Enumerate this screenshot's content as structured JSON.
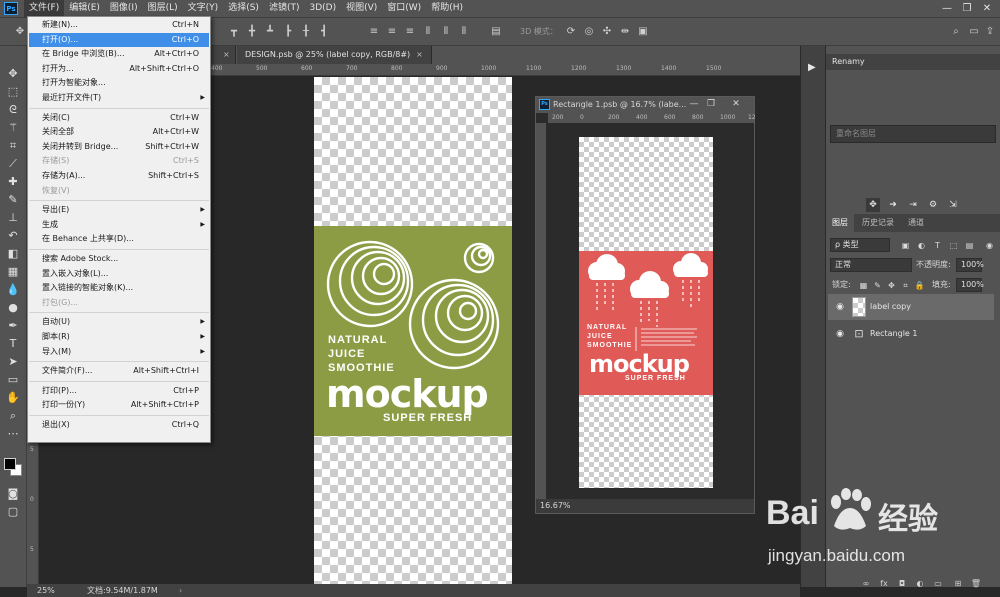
{
  "app": {
    "logo": "Ps"
  },
  "menubar": {
    "items": [
      "文件(F)",
      "编辑(E)",
      "图像(I)",
      "图层(L)",
      "文字(Y)",
      "选择(S)",
      "滤镜(T)",
      "3D(D)",
      "视图(V)",
      "窗口(W)",
      "帮助(H)"
    ],
    "window_controls": [
      "minimize-icon",
      "restore-icon",
      "close-icon"
    ]
  },
  "options_bar": {
    "mode_3d_label": "3D 模式："
  },
  "file_menu": {
    "groups": [
      [
        {
          "label": "新建(N)...",
          "shortcut": "Ctrl+N"
        },
        {
          "label": "打开(O)...",
          "shortcut": "Ctrl+O",
          "highlighted": true
        },
        {
          "label": "在 Bridge 中浏览(B)...",
          "shortcut": "Alt+Ctrl+O"
        },
        {
          "label": "打开为...",
          "shortcut": "Alt+Shift+Ctrl+O"
        },
        {
          "label": "打开为智能对象...",
          "shortcut": ""
        },
        {
          "label": "最近打开文件(T)",
          "shortcut": "",
          "submenu": true
        }
      ],
      [
        {
          "label": "关闭(C)",
          "shortcut": "Ctrl+W"
        },
        {
          "label": "关闭全部",
          "shortcut": "Alt+Ctrl+W"
        },
        {
          "label": "关闭并转到 Bridge...",
          "shortcut": "Shift+Ctrl+W"
        },
        {
          "label": "存储(S)",
          "shortcut": "Ctrl+S",
          "disabled": true
        },
        {
          "label": "存储为(A)...",
          "shortcut": "Shift+Ctrl+S"
        },
        {
          "label": "恢复(V)",
          "shortcut": "",
          "disabled": true
        }
      ],
      [
        {
          "label": "导出(E)",
          "shortcut": "",
          "submenu": true
        },
        {
          "label": "生成",
          "shortcut": "",
          "submenu": true
        },
        {
          "label": "在 Behance 上共享(D)...",
          "shortcut": ""
        }
      ],
      [
        {
          "label": "搜索 Adobe Stock...",
          "shortcut": ""
        },
        {
          "label": "置入嵌入对象(L)...",
          "shortcut": ""
        },
        {
          "label": "置入链接的智能对象(K)...",
          "shortcut": ""
        },
        {
          "label": "打包(G)...",
          "shortcut": "",
          "disabled": true
        }
      ],
      [
        {
          "label": "自动(U)",
          "shortcut": "",
          "submenu": true
        },
        {
          "label": "脚本(R)",
          "shortcut": "",
          "submenu": true
        },
        {
          "label": "导入(M)",
          "shortcut": "",
          "submenu": true
        }
      ],
      [
        {
          "label": "文件简介(F)...",
          "shortcut": "Alt+Shift+Ctrl+I"
        }
      ],
      [
        {
          "label": "打印(P)...",
          "shortcut": "Ctrl+P"
        },
        {
          "label": "打印一份(Y)",
          "shortcut": "Alt+Shift+Ctrl+P"
        }
      ],
      [
        {
          "label": "退出(X)",
          "shortcut": "Ctrl+Q"
        }
      ]
    ]
  },
  "tabs": {
    "first_close": "×",
    "design_tab": "DESIGN.psb @ 25% (label copy, RGB/8#)",
    "close": "×"
  },
  "rulers": {
    "h": [
      "0",
      "100",
      "200",
      "300",
      "400",
      "500",
      "600",
      "700",
      "800",
      "900",
      "1000",
      "1100",
      "1200",
      "1300",
      "1400",
      "1500"
    ],
    "v": [
      "0",
      "5",
      "0",
      "5",
      "0",
      "5",
      "0",
      "5",
      "0",
      "5"
    ]
  },
  "main_doc": {
    "label_color": "#8b9c45",
    "line1": "NATURAL",
    "line2": "JUICE",
    "line3": "SMOOTHIE",
    "brand": "mockup",
    "tagline": "SUPER FRESH"
  },
  "float_window": {
    "title": "Rectangle 1.psb @ 16.7% (labe...",
    "zoom": "16.67%",
    "label_color": "#e05a58",
    "line1": "NATURAL",
    "line2": "JUICE",
    "line3": "SMOOTHIE",
    "brand": "mockup",
    "tagline": "SUPER FRESH",
    "ruler_h": [
      "200",
      "0",
      "200",
      "400",
      "600",
      "800",
      "1000",
      "12"
    ]
  },
  "renamy": {
    "title": "Renamy",
    "placeholder": "重命名图层"
  },
  "layers_panel": {
    "tabs": [
      "图层",
      "历史记录",
      "通道"
    ],
    "filter_kind": "ρ 类型",
    "blend_mode": "正常",
    "opacity_label": "不透明度:",
    "opacity_value": "100%",
    "lock_label": "锁定:",
    "fill_label": "填充:",
    "fill_value": "100%",
    "layers": [
      {
        "name": "label copy",
        "selected": true
      },
      {
        "name": "Rectangle 1",
        "selected": false
      }
    ]
  },
  "statusbar": {
    "zoom": "25%",
    "doc_info": "文档:9.54M/1.87M"
  },
  "watermark": {
    "brand": "Bai",
    "brand2": "经验",
    "url": "jingyan.baidu.com"
  }
}
